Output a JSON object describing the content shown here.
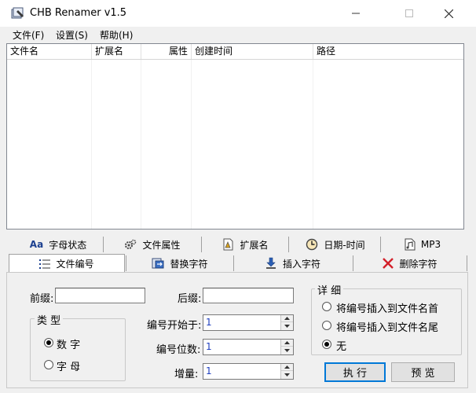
{
  "window": {
    "title": "CHB Renamer v1.5"
  },
  "menu": [
    "文件(F)",
    "设置(S)",
    "帮助(H)"
  ],
  "columns": [
    "文件名",
    "扩展名",
    "属性",
    "创建时间",
    "路径"
  ],
  "tabs_row1": [
    "字母状态",
    "文件属性",
    "扩展名",
    "日期-时间",
    "MP3"
  ],
  "tabs_row2": [
    "文件编号",
    "替换字符",
    "插入字符",
    "删除字符"
  ],
  "tab_icon_text": "Aa",
  "form": {
    "prefix_label": "前缀:",
    "suffix_label": "后缀:",
    "prefix_value": "",
    "suffix_value": "",
    "start_label": "编号开始于:",
    "start_value": "1",
    "digits_label": "编号位数:",
    "digits_value": "1",
    "increment_label": "增量:",
    "increment_value": "1"
  },
  "type_group": {
    "title": "类 型",
    "options": [
      "数 字",
      "字 母"
    ],
    "selected": 0
  },
  "detail_group": {
    "title": "详 细",
    "options": [
      "将编号插入到文件名首",
      "将编号插入到文件名尾",
      "无"
    ],
    "selected": 2
  },
  "buttons": {
    "execute": "执 行",
    "preview": "预 览"
  },
  "colors": {
    "close_red": "#e81123",
    "accent": "#0078d7",
    "spin_text": "#1f3fbf"
  }
}
